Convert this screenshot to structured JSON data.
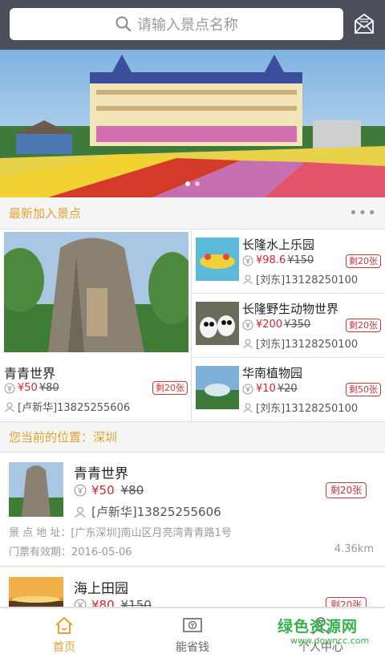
{
  "header": {
    "search_placeholder": "请输入景点名称",
    "icons": {
      "search": "search-icon",
      "message": "mail-icon"
    }
  },
  "banner": {
    "slide_count": 2,
    "active_slide": 1
  },
  "new_spots": {
    "title": "最新加入景点",
    "more_label": "•••",
    "featured": {
      "name": "青青世界",
      "price": "¥50",
      "original_price": "¥80",
      "remaining": "剩20张",
      "contact": "[卢新华]13825255606"
    },
    "items": [
      {
        "name": "长隆水上乐园",
        "price": "¥98.6",
        "original_price": "¥150",
        "remaining": "剩20张",
        "contact": "[刘东]13128250100"
      },
      {
        "name": "长隆野生动物世界",
        "price": "¥200",
        "original_price": "¥350",
        "remaining": "剩20张",
        "contact": "[刘东]13128250100"
      },
      {
        "name": "华南植物园",
        "price": "¥10",
        "original_price": "¥20",
        "remaining": "剩50张",
        "contact": "[刘东]13128250100"
      }
    ]
  },
  "location": {
    "label": "您当前的位置：深圳"
  },
  "list": [
    {
      "name": "青青世界",
      "price": "¥50",
      "original_price": "¥80",
      "remaining": "剩20张",
      "contact": "[卢新华]13825255606",
      "address": "景 点 地 址：[广东深圳]南山区月亮湾青青路1号",
      "valid_until": "门票有效期：2016-05-06",
      "distance": "4.36km"
    },
    {
      "name": "海上田园",
      "price": "¥80",
      "original_price": "¥150",
      "remaining": "剩20张"
    }
  ],
  "tabbar": [
    {
      "label": "首页",
      "icon": "home-icon",
      "active": true
    },
    {
      "label": "能省钱",
      "icon": "coupon-icon",
      "active": false
    },
    {
      "label": "个人中心",
      "icon": "user-icon",
      "active": false
    }
  ],
  "watermark": {
    "title": "绿色资源网",
    "url": "www.downcc.com"
  },
  "colors": {
    "topbar": "#4b4f5a",
    "accent": "#e2a22f",
    "price": "#d6262c",
    "badge": "#c73a3a"
  }
}
